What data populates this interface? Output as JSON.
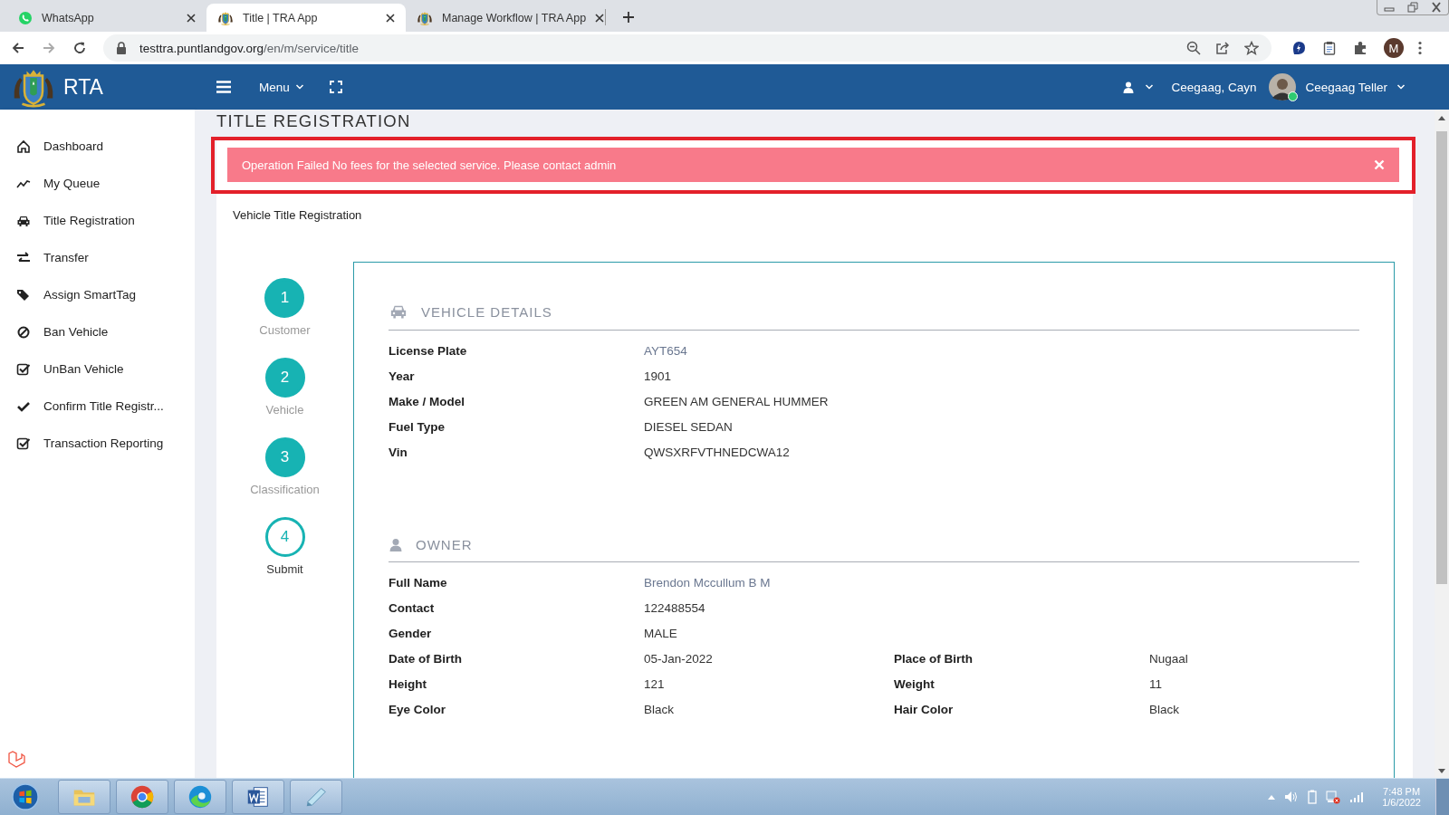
{
  "browser": {
    "tabs": [
      {
        "title": "WhatsApp",
        "kind": "chat",
        "selected": false
      },
      {
        "title": "Title | TRA App",
        "kind": "emblem",
        "selected": true
      },
      {
        "title": "Manage Workflow | TRA App",
        "kind": "emblem",
        "selected": false
      }
    ],
    "url": {
      "host": "testtra.puntlandgov.org",
      "path": "/en/m/service/title"
    },
    "profile_initial": "M"
  },
  "header": {
    "brand": "RTA",
    "menu_label": "Menu",
    "user_name": "Ceegaag, Cayn",
    "user_role": "Ceegaag Teller",
    "online": true
  },
  "sidebar": {
    "items": [
      {
        "label": "Dashboard"
      },
      {
        "label": "My Queue"
      },
      {
        "label": "Title Registration"
      },
      {
        "label": "Transfer"
      },
      {
        "label": "Assign SmartTag"
      },
      {
        "label": "Ban Vehicle"
      },
      {
        "label": "UnBan Vehicle"
      },
      {
        "label": "Confirm Title Registr..."
      },
      {
        "label": "Transaction Reporting"
      }
    ]
  },
  "page_title": "TITLE REGISTRATION",
  "alert": {
    "message": "Operation Failed No fees for the selected service. Please contact admin"
  },
  "form_title": "Vehicle Title Registration",
  "steps": [
    {
      "number": "1",
      "label": "Customer",
      "completed": true
    },
    {
      "number": "2",
      "label": "Vehicle",
      "completed": true
    },
    {
      "number": "3",
      "label": "Classification",
      "completed": true
    },
    {
      "number": "4",
      "label": "Submit",
      "completed": false
    }
  ],
  "sections": [
    {
      "heading": "VEHICLE DETAILS",
      "rows": [
        [
          {
            "label": "License Plate",
            "value": "AYT654",
            "link": true
          }
        ],
        [
          {
            "label": "Year",
            "value": "1901",
            "link": false
          }
        ],
        [
          {
            "label": "Make / Model",
            "value": "GREEN AM GENERAL HUMMER",
            "link": false
          }
        ],
        [
          {
            "label": "Fuel Type",
            "value": "DIESEL SEDAN",
            "link": false
          }
        ],
        [
          {
            "label": "Vin",
            "value": "QWSXRFVTHNEDCWA12",
            "link": false
          }
        ]
      ]
    },
    {
      "heading": "OWNER",
      "rows": [
        [
          {
            "label": "Full Name",
            "value": "Brendon Mccullum B M",
            "link": true
          }
        ],
        [
          {
            "label": "Contact",
            "value": "122488554",
            "link": false
          }
        ],
        [
          {
            "label": "Gender",
            "value": "MALE",
            "link": false
          }
        ],
        [
          {
            "label": "Date of Birth",
            "value": "05-Jan-2022",
            "link": false
          },
          {
            "label": "Place of Birth",
            "value": "Nugaal",
            "link": false
          }
        ],
        [
          {
            "label": "Height",
            "value": "121",
            "link": false
          },
          {
            "label": "Weight",
            "value": "11",
            "link": false
          }
        ],
        [
          {
            "label": "Eye Color",
            "value": "Black",
            "link": false
          },
          {
            "label": "Hair Color",
            "value": "Black",
            "link": false
          }
        ]
      ]
    }
  ],
  "taskbar": {
    "time": "7:48 PM",
    "date": "1/6/2022"
  }
}
